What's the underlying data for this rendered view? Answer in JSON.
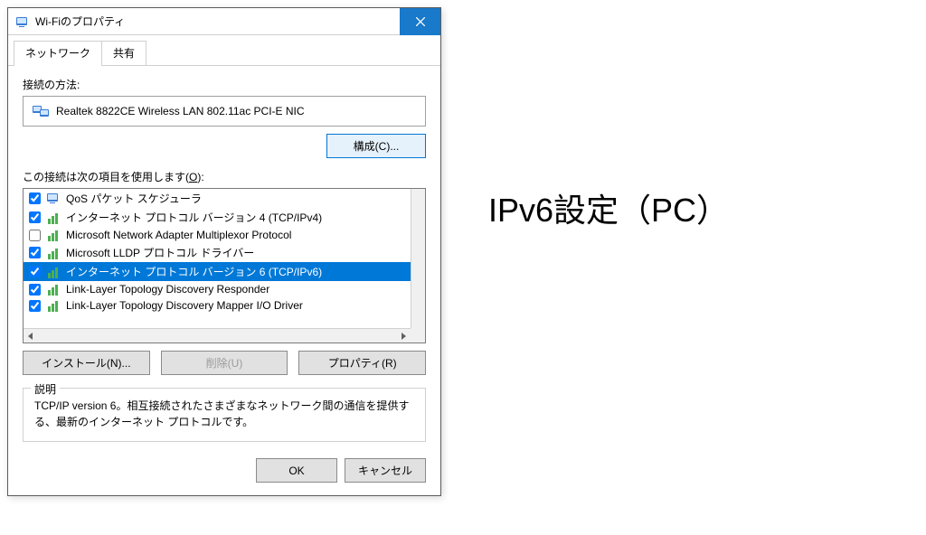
{
  "dialog": {
    "title": "Wi-Fiのプロパティ",
    "tabs": [
      "ネットワーク",
      "共有"
    ],
    "active_tab": 0,
    "connect_method_label": "接続の方法:",
    "adapter_name": "Realtek 8822CE Wireless LAN 802.11ac PCI-E NIC",
    "configure_btn": "構成(C)...",
    "items_label_pre": "この接続は次の項目を使用します(",
    "items_label_key": "O",
    "items_label_post": "):",
    "items": [
      {
        "checked": true,
        "icon": "monitor",
        "label": "QoS パケット スケジューラ",
        "selected": false
      },
      {
        "checked": true,
        "icon": "proto",
        "label": "インターネット プロトコル バージョン 4 (TCP/IPv4)",
        "selected": false
      },
      {
        "checked": false,
        "icon": "proto",
        "label": "Microsoft Network Adapter Multiplexor Protocol",
        "selected": false
      },
      {
        "checked": true,
        "icon": "proto",
        "label": "Microsoft LLDP プロトコル ドライバー",
        "selected": false
      },
      {
        "checked": true,
        "icon": "proto",
        "label": "インターネット プロトコル バージョン 6 (TCP/IPv6)",
        "selected": true
      },
      {
        "checked": true,
        "icon": "proto",
        "label": "Link-Layer Topology Discovery Responder",
        "selected": false
      },
      {
        "checked": true,
        "icon": "proto",
        "label": "Link-Layer Topology Discovery Mapper I/O Driver",
        "selected": false
      }
    ],
    "install_btn": "インストール(N)...",
    "uninstall_btn": "削除(U)",
    "uninstall_disabled": true,
    "properties_btn": "プロパティ(R)",
    "desc_group_title": "説明",
    "desc_text": "TCP/IP version 6。相互接続されたさまざまなネットワーク間の通信を提供する、最新のインターネット プロトコルです。",
    "ok_btn": "OK",
    "cancel_btn": "キャンセル"
  },
  "side_title": "IPv6設定（PC）"
}
